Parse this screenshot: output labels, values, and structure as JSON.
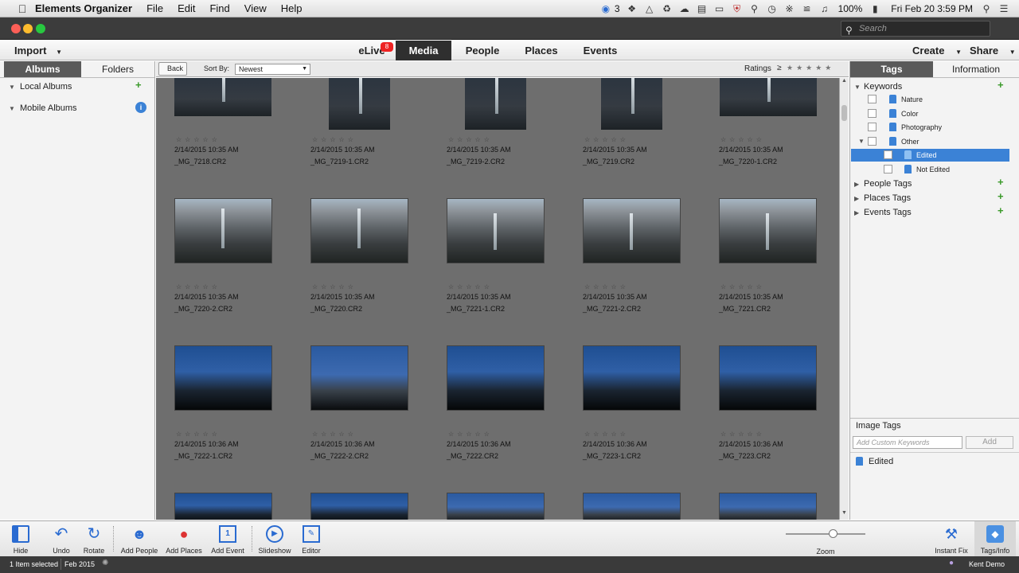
{
  "mac_menu": {
    "app": "Elements Organizer",
    "items": [
      "File",
      "Edit",
      "Find",
      "View",
      "Help"
    ],
    "notif_count": "3",
    "battery": "100%",
    "clock": "Fri Feb 20  3:59 PM"
  },
  "search": {
    "placeholder": "Search"
  },
  "topnav": {
    "import": "Import",
    "elive": "eLive",
    "elive_badge": "8",
    "tabs": [
      "Media",
      "People",
      "Places",
      "Events"
    ],
    "create": "Create",
    "share": "Share"
  },
  "left": {
    "tab_albums": "Albums",
    "tab_folders": "Folders",
    "local_albums": "Local Albums",
    "mobile_albums": "Mobile Albums"
  },
  "toolbar": {
    "back": "Back",
    "sort_label": "Sort By:",
    "sort_value": "Newest",
    "ratings": "Ratings",
    "ratings_op": "≥"
  },
  "media": [
    {
      "date": "2/14/2015 10:35 AM",
      "name": "_MG_7218.CR2"
    },
    {
      "date": "2/14/2015 10:35 AM",
      "name": "_MG_7219-1.CR2"
    },
    {
      "date": "2/14/2015 10:35 AM",
      "name": "_MG_7219-2.CR2"
    },
    {
      "date": "2/14/2015 10:35 AM",
      "name": "_MG_7219.CR2"
    },
    {
      "date": "2/14/2015 10:35 AM",
      "name": "_MG_7220-1.CR2"
    },
    {
      "date": "2/14/2015 10:35 AM",
      "name": "_MG_7220-2.CR2"
    },
    {
      "date": "2/14/2015 10:35 AM",
      "name": "_MG_7220.CR2"
    },
    {
      "date": "2/14/2015 10:35 AM",
      "name": "_MG_7221-1.CR2"
    },
    {
      "date": "2/14/2015 10:35 AM",
      "name": "_MG_7221-2.CR2"
    },
    {
      "date": "2/14/2015 10:35 AM",
      "name": "_MG_7221.CR2"
    },
    {
      "date": "2/14/2015 10:36 AM",
      "name": "_MG_7222-1.CR2"
    },
    {
      "date": "2/14/2015 10:36 AM",
      "name": "_MG_7222-2.CR2"
    },
    {
      "date": "2/14/2015 10:36 AM",
      "name": "_MG_7222.CR2"
    },
    {
      "date": "2/14/2015 10:36 AM",
      "name": "_MG_7223-1.CR2"
    },
    {
      "date": "2/14/2015 10:36 AM",
      "name": "_MG_7223.CR2"
    }
  ],
  "right": {
    "tab_tags": "Tags",
    "tab_info": "Information",
    "keywords": "Keywords",
    "kw": [
      "Nature",
      "Color",
      "Photography",
      "Other"
    ],
    "kw_sub": [
      "Edited",
      "Not Edited"
    ],
    "people_tags": "People Tags",
    "places_tags": "Places Tags",
    "events_tags": "Events Tags",
    "image_tags": "Image Tags",
    "custom_placeholder": "Add Custom Keywords",
    "add": "Add",
    "applied": "Edited"
  },
  "bottom": {
    "hide": "Hide",
    "undo": "Undo",
    "rotate": "Rotate",
    "add_people": "Add People",
    "add_places": "Add Places",
    "add_event": "Add Event",
    "slideshow": "Slideshow",
    "editor": "Editor",
    "zoom": "Zoom",
    "instant_fix": "Instant Fix",
    "tags_info": "Tags/Info"
  },
  "status": {
    "selected": "1 Item selected",
    "date": "Feb 2015",
    "user": "Kent Demo"
  },
  "colors": {
    "accent": "#3b82d6",
    "selection": "#3b82d6",
    "badge": "#e22222"
  }
}
